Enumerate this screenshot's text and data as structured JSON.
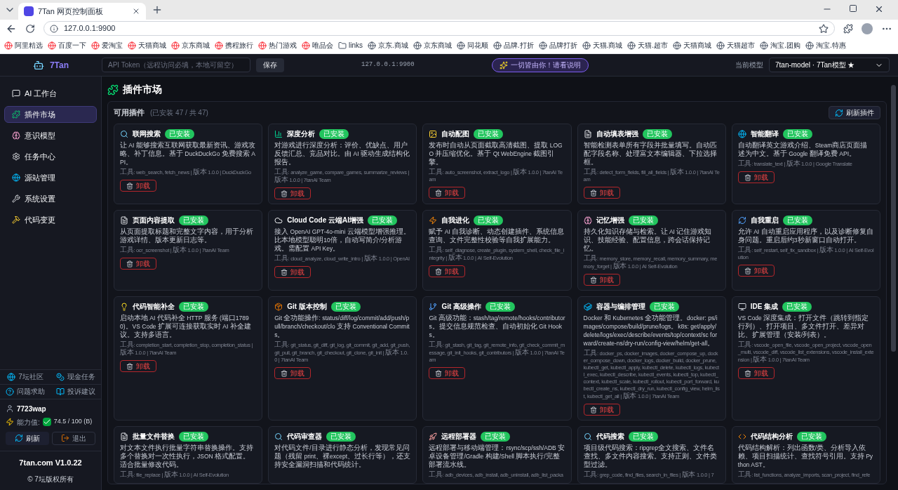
{
  "browser": {
    "tab_title": "7Tan 网页控制面板",
    "url": "127.0.0.1:9900",
    "bookmarks": [
      "阿里精选",
      "百度一下",
      "爱淘宝",
      "天猫商城",
      "京东商城",
      "携程旅行",
      "热门游戏",
      "唯品会",
      "links",
      "京东.商城",
      "京东商城",
      "同花顺",
      "品牌.打折",
      "品牌打折",
      "天猫.商城",
      "天猫.超市",
      "天猫商城",
      "天猫超市",
      "淘宝.团购",
      "淘宝.特惠"
    ]
  },
  "header": {
    "logo": "7Tan",
    "token_placeholder": "API Token（远程访问必填，本地可留空）",
    "save": "保存",
    "address": "127.0.0.1:9900",
    "promo": "一切皆由你！请看说明",
    "model_label": "当前模型",
    "model": "7tan-model · 7Tan模型 ★"
  },
  "sidebar": {
    "items": [
      {
        "label": "AI 工作台",
        "selected": false
      },
      {
        "label": "插件市场",
        "selected": true
      },
      {
        "label": "意识模型",
        "selected": false
      },
      {
        "label": "任务中心",
        "selected": false
      },
      {
        "label": "源站管理",
        "selected": false
      },
      {
        "label": "系统设置",
        "selected": false
      },
      {
        "label": "代码变更",
        "selected": false
      }
    ],
    "links": [
      "7坛社区",
      "现金任务",
      "问题求助",
      "投诉建议"
    ],
    "user": "7723wap",
    "ability_label": "能力值:",
    "ability": "74.5 / 100 (B)",
    "refresh": "刷新",
    "logout": "退出",
    "version": "7tan.com V1.0.22",
    "copyright": "© 7坛版权所有"
  },
  "page": {
    "title": "插件市场",
    "section": "可用插件",
    "count": "(已安装 47 / 共 47)",
    "refresh": "刷新插件"
  },
  "plugins": [
    {
      "name": "联网搜索",
      "badge": "已安装",
      "desc": "让 AI 能够搜索互联网获取最新资讯、游戏攻略、补丁信息。基于 DuckDuckGo 免费搜索 API。",
      "meta": "工具: web_search, fetch_news | 版本 1.0.0 | DuckDuckGo",
      "action": "卸载"
    },
    {
      "name": "深度分析",
      "badge": "已安装",
      "desc": "对游戏进行深度分析：评价、优缺点、用户反馈汇总、竞品对比。由 AI 驱动生成结构化报告。",
      "meta": "工具: analyze_game, compare_games, summarize_reviews | 版本 1.0.0 | 7tanAI Team",
      "action": "卸载"
    },
    {
      "name": "自动配图",
      "badge": "已安装",
      "desc": "发布时自动从页面截取高清截图、提取 LOGO 并压缩优化。基于 Qt WebEngine 截图引擎。",
      "meta": "工具: auto_screenshot, extract_logo | 版本 1.0.0 | 7tanAI Team",
      "action": "卸载"
    },
    {
      "name": "自动填表增强",
      "badge": "已安装",
      "desc": "智能检测表单所有字段并批量填写。自动匹配字段名称、处理富文本编辑器、下拉选择框。",
      "meta": "工具: detect_form_fields, fill_all_fields | 版本 1.0.0 | 7tanAI Team",
      "action": "卸载"
    },
    {
      "name": "智能翻译",
      "badge": "已安装",
      "desc": "自动翻译英文游戏介绍、Steam商店页面描述为中文。基于 Google 翻译免费 API。",
      "meta": "工具: translate_text | 版本 1.0.0 | Google Translate",
      "action": "卸载"
    },
    {
      "name": "页面内容提取",
      "badge": "已安装",
      "desc": "从页面提取标题和完整文字内容，用于分析游戏详情、版本更新日志等。",
      "meta": "工具: ocr_screenshot | 版本 1.0.0 | 7tanAI Team",
      "action": "卸载"
    },
    {
      "name": "Cloud Code 云端AI增强",
      "badge": "已安装",
      "desc": "接入 OpenAI GPT-4o-mini 云端模型增强推理。比本地模型聪明10倍，自动写简介/分析游戏。需配置 API Key。",
      "meta": "工具: cloud_analyze, cloud_write_intro | 版本 1.0.0 | OpenAI",
      "action": "卸载"
    },
    {
      "name": "自我进化",
      "badge": "已安装",
      "desc": "赋予 AI 自我诊断、动态创建插件、系统信息查询、文件完整性校验等自我扩展能力。",
      "meta": "工具: self_diagnose, create_plugin, system_shell, check_file_integrity | 版本 1.0.0 | AI Self-Evolution",
      "action": "卸载"
    },
    {
      "name": "记忆增强",
      "badge": "已安装",
      "desc": "持久化知识存储与检索。让 AI 记住游戏知识、技能经验、配置信息，跨会话保持记忆。",
      "meta": "工具: memory_store, memory_recall, memory_summary, memory_forget | 版本 1.0.0 | AI Self-Evolution",
      "action": "卸载"
    },
    {
      "name": "自我重启",
      "badge": "已安装",
      "desc": "允许 AI 自动重启应用程序，以及诊断修复自身问题。重启后约3秒新窗口自动打开。",
      "meta": "工具: self_restart, self_fix_sandbox | 版本 1.0.0 | AI Self-Evolution",
      "action": "卸载"
    },
    {
      "name": "代码智能补全",
      "badge": "已安装",
      "desc": "启动本地 AI 代码补全 HTTP 服务 (端口17890)。VS Code 扩展可连接获取实时 AI 补全建议。支持多语言。",
      "meta": "工具: completion_start, completion_stop, completion_status | 版本 1.0.0 | 7tanAI Team",
      "action": "卸载"
    },
    {
      "name": "Git 版本控制",
      "badge": "已安装",
      "desc": "Git 全功能操作: status/diff/log/commit/add/push/pull/branch/checkout/clo 支持 Conventional Commits。",
      "meta": "工具: git_status, git_diff, git_log, git_commit, git_add, git_push, git_pull, git_branch, git_checkout, git_clone, git_init | 版本 1.0.0 | 7tanAI Team",
      "action": "卸载"
    },
    {
      "name": "Git 高级操作",
      "badge": "已安装",
      "desc": "Git 高级功能：stash/tag/remote/hooks/contributors。提交信息规范检查、自动初始化 Git Hooks。",
      "meta": "工具: git_stash, git_tag, git_remote_info, git_check_commit_message, git_init_hooks, git_contributors | 版本 1.0.0 | 7tanAI Team",
      "action": "卸载"
    },
    {
      "name": "容器与编排管理",
      "badge": "已安装",
      "desc": "Docker 和 Kubernetes 全功能管理。docker: ps/images/compose/build/prune/logs。k8s: get/apply/delete/logs/exec/describe/events/top/context/sc forward/create-ns/dry-run/config-view/helm/get-all。",
      "meta": "工具: docker_ps, docker_images, docker_compose_up, docker_compose_down, docker_logs, docker_build, docker_prune, kubectl_get, kubectl_apply, kubectl_delete, kubectl_logs, kubectl_exec, kubectl_describe, kubectl_events, kubectl_top, kubectl_context, kubectl_scale, kubectl_rollout, kubectl_port_forward, kubectl_create_ns, kubectl_dry_run, kubectl_config_view, helm_list, kubectl_get_all | 版本 1.0.0 | 7tanAI Team",
      "action": "卸载"
    },
    {
      "name": "IDE 集成",
      "badge": "已安装",
      "desc": "VS Code 深度集成：打开文件（跳转到指定行列）、打开项目、多文件打开、差异对比、扩展管理（安装/列表）。",
      "meta": "工具: vscode_open_file, vscode_open_project, vscode_open_multi, vscode_diff, vscode_list_extensions, vscode_install_extension | 版本 1.0.0 | 7tanAI Team",
      "action": "卸载"
    },
    {
      "name": "批量文件替换",
      "badge": "已安装",
      "desc": "对文本文件执行批量字符串替换操作。支持多个替换对一次性执行，JSON 格式配置。适合批量修改代码。",
      "meta": "工具: file_replace | 版本 1.0.0 | AI Self-Evolution"
    },
    {
      "name": "代码审查器",
      "badge": "已安装",
      "desc": "对代码文件/目录进行静态分析，发现常见问题（残留 print、裸except、过长行等），还支持安全漏洞扫描和代码统计。"
    },
    {
      "name": "远程部署器",
      "badge": "已安装",
      "desc": "远程部署与移动端管理：rsync/scp/ssh/ADB 安卓设备管理/Gradle 构建/Shell 脚本执行/完整部署流水线。",
      "meta": "工具: adb_devices, adb_install, adb_uninstall, adb_list_packa"
    },
    {
      "name": "代码搜索",
      "badge": "已安装",
      "desc": "项目级代码搜索：ripgrep全文搜索、文件名查找、多文件内容搜索。支持正则、文件类型过滤。",
      "meta": "工具: grep_code, find_files, search_in_files | 版本 1.0.0 | 7"
    },
    {
      "name": "代码结构分析",
      "badge": "已安装",
      "desc": "代码结构解析：列出函数/类、分析导入依赖、项目扫描统计、查找符号引用。支持 Python AST。",
      "meta": "工具: list_functions, analyze_imports, scan_project, find_refe"
    }
  ]
}
